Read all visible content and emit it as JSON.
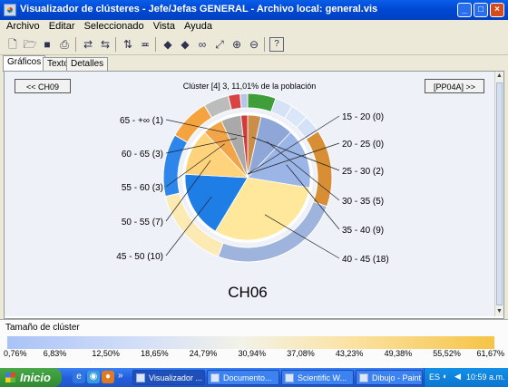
{
  "window": {
    "title": "Visualizador de clústeres - Jefe/Jefas GENERAL - Archivo local: general.vis",
    "buttons": {
      "minimize": "_",
      "maximize": "□",
      "close": "×"
    }
  },
  "menu": [
    "Archivo",
    "Editar",
    "Seleccionado",
    "Vista",
    "Ayuda"
  ],
  "toolbar": {
    "icons": [
      "new-file-icon",
      "open-folder-icon",
      "save-icon",
      "print-icon",
      "swap-icon",
      "swap-back-icon",
      "sort-icon",
      "filter-icon",
      "arrow-left-icon",
      "arrow-right-icon",
      "binoculars-icon",
      "cursor-icon",
      "zoom-in-icon",
      "zoom-out-icon",
      "help-icon"
    ]
  },
  "tabs": [
    "Gráficos",
    "Texto",
    "Detalles"
  ],
  "plot": {
    "prev_button": "<< CH09",
    "next_button": "[PP04A] >>",
    "header": "Clúster [4] 3, 11,01% de la población",
    "center_label": "CH06"
  },
  "chart_data": {
    "type": "pie",
    "title": "Clúster [4] 3, 11,01% de la población",
    "categories": [
      "15 - 20 (0)",
      "20 - 25 (0)",
      "25 - 30 (2)",
      "30 - 35 (5)",
      "35 - 40 (9)",
      "40 - 45 (18)",
      "45 - 50 (10)",
      "50 - 55 (7)",
      "55 - 60 (3)",
      "60 - 65 (3)",
      "65 - +∞ (1)"
    ],
    "counts": [
      0,
      0,
      2,
      5,
      9,
      18,
      10,
      7,
      3,
      3,
      1
    ],
    "inner_colors": [
      "#3f9e3a",
      "#c9a46a",
      "#c98f4a",
      "#8ea7d8",
      "#9bb5e6",
      "#ffe79c",
      "#1e7ee6",
      "#ffd37c",
      "#f2a548",
      "#a9a9a9",
      "#d33a3a"
    ],
    "outer_ring": [
      {
        "value": 19,
        "color": "#3f9e3a"
      },
      {
        "value": 12,
        "color": "#d6e3f7"
      },
      {
        "value": 12,
        "color": "#dbe6f8"
      },
      {
        "value": 12,
        "color": "#d5e1f6"
      },
      {
        "value": 52,
        "color": "#d88e35"
      },
      {
        "value": 88,
        "color": "#9fb4dd"
      },
      {
        "value": 55,
        "color": "#fbeab4"
      },
      {
        "value": 42,
        "color": "#2f86ea"
      },
      {
        "value": 28,
        "color": "#f4a33e"
      },
      {
        "value": 17,
        "color": "#bcbcbc"
      },
      {
        "value": 8,
        "color": "#d94343"
      },
      {
        "value": 5,
        "color": "#b7c6e6"
      }
    ]
  },
  "legend": {
    "title": "Tamaño de clúster",
    "ticks": [
      "0,76%",
      "6,83%",
      "12,50%",
      "18,65%",
      "24,79%",
      "30,94%",
      "37,08%",
      "43,23%",
      "49,38%",
      "55,52%",
      "61,67%"
    ]
  },
  "taskbar": {
    "start": "Inicio",
    "quicklaunch_more": "»",
    "tasks": [
      "Visualizador ...",
      "Documento...",
      "Scientific W...",
      "Dibujo - Paint"
    ],
    "lang": "ES",
    "clock": "10:59 a.m."
  }
}
